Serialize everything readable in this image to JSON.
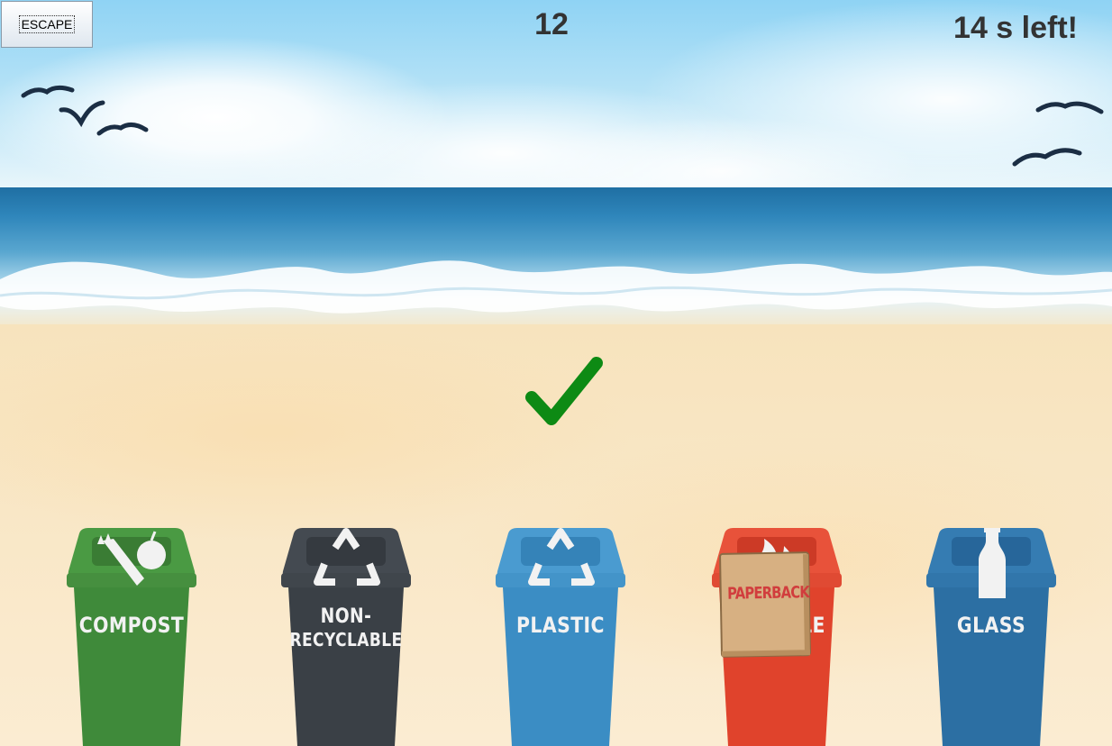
{
  "hud": {
    "escape_label": "ESCAPE",
    "score": "12",
    "timer": "14 s left!"
  },
  "feedback": {
    "icon": "check-mark-icon",
    "color": "#0d8a14"
  },
  "bins": [
    {
      "id": "compost",
      "lines": [
        "COMPOST"
      ],
      "color": "#3f8a3a",
      "icon": "vegetable-icon"
    },
    {
      "id": "non-recyclable",
      "lines": [
        "NON-",
        "RECYCLABLE"
      ],
      "color": "#3a4046",
      "icon": "recycle-icon"
    },
    {
      "id": "plastic",
      "lines": [
        "PLASTIC"
      ],
      "color": "#3b8dc4",
      "icon": "recycle-icon"
    },
    {
      "id": "paper",
      "lines": [
        "LE"
      ],
      "color": "#e0432c",
      "icon": "flame-icon"
    },
    {
      "id": "glass",
      "lines": [
        "GLASS"
      ],
      "color": "#2c6fa3",
      "icon": "bottle-icon"
    }
  ],
  "dragged_item": {
    "label": "PAPERBACK",
    "icon": "book-icon"
  }
}
